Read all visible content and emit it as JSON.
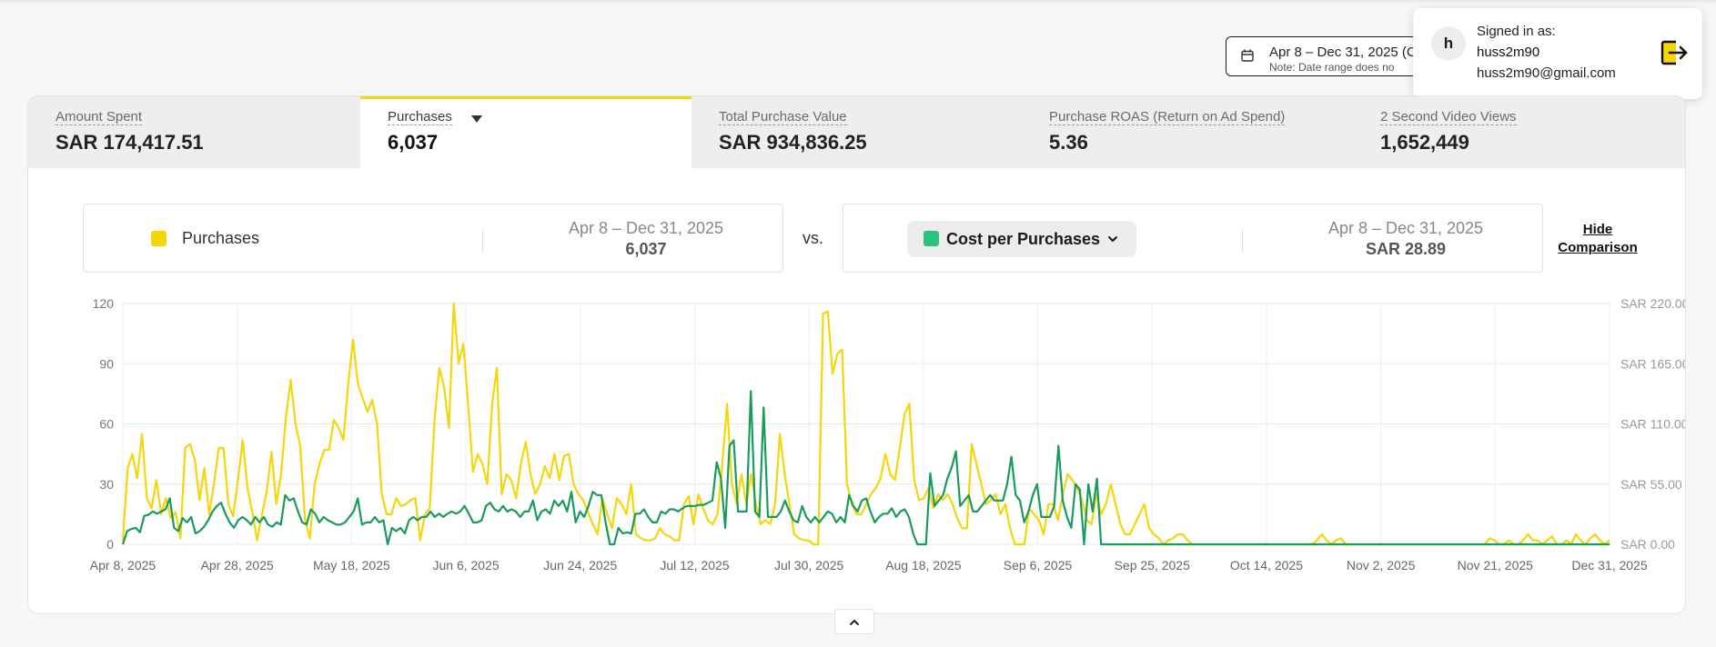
{
  "header": {
    "date_range": "Apr 8 – Dec 31, 2025 (C",
    "date_note": "Note: Date range does no"
  },
  "user": {
    "signed_in_label": "Signed in as:",
    "avatar_initial": "h",
    "username": "huss2m90",
    "email": "huss2m90@gmail.com"
  },
  "metrics": [
    {
      "label": "Amount Spent",
      "value": "SAR 174,417.51"
    },
    {
      "label": "Purchases",
      "value": "6,037",
      "active": true
    },
    {
      "label": "Total Purchase Value",
      "value": "SAR 934,836.25"
    },
    {
      "label": "Purchase ROAS (Return on Ad Spend)",
      "value": "5.36"
    },
    {
      "label": "2 Second Video Views",
      "value": "1,652,449"
    }
  ],
  "comparison": {
    "left_metric": "Purchases",
    "left_range": "Apr 8 – Dec 31, 2025",
    "left_value": "6,037",
    "vs": "vs.",
    "right_metric": "Cost per Purchases",
    "right_range": "Apr 8 – Dec 31, 2025",
    "right_value": "SAR 28.89",
    "hide_line1": "Hide",
    "hide_line2": "Comparison"
  },
  "colors": {
    "accent": "#f5d60a",
    "purchases": "#f5d60a",
    "cost": "#1a9b5c",
    "cost_swatch": "#2ec27e"
  },
  "icons": {
    "date": "calendar-icon",
    "logout": "logout-icon",
    "metric_menu": "chevron-down-icon",
    "collapse": "chevron-up-icon"
  },
  "chart_data": {
    "type": "line",
    "x_ticks": [
      "Apr 8, 2025",
      "Apr 28, 2025",
      "May 18, 2025",
      "Jun 6, 2025",
      "Jun 24, 2025",
      "Jul 12, 2025",
      "Jul 30, 2025",
      "Aug 18, 2025",
      "Sep 6, 2025",
      "Sep 25, 2025",
      "Oct 14, 2025",
      "Nov 2, 2025",
      "Nov 21, 2025",
      "Dec 31, 2025"
    ],
    "y_left_ticks": [
      "0",
      "30",
      "60",
      "90",
      "120"
    ],
    "y_right_ticks": [
      "SAR 0.00",
      "SAR 55.00",
      "SAR 110.00",
      "SAR 165.00",
      "SAR 220.00"
    ],
    "y_left_lim": [
      0,
      120
    ],
    "y_right_lim": [
      0,
      220
    ],
    "grid": true,
    "series": [
      {
        "name": "Purchases",
        "axis": "left",
        "values": [
          2,
          38,
          45,
          33,
          55,
          23,
          18,
          32,
          15,
          23,
          13,
          16,
          3,
          48,
          50,
          42,
          22,
          38,
          15,
          30,
          48,
          48,
          20,
          14,
          32,
          52,
          28,
          16,
          2,
          15,
          26,
          46,
          20,
          35,
          63,
          82,
          60,
          49,
          12,
          3,
          30,
          40,
          47,
          47,
          62,
          58,
          52,
          80,
          102,
          80,
          73,
          66,
          72,
          60,
          25,
          15,
          15,
          23,
          19,
          20,
          22,
          23,
          2,
          15,
          18,
          62,
          88,
          78,
          58,
          120,
          90,
          100,
          70,
          36,
          45,
          40,
          30,
          70,
          88,
          25,
          35,
          32,
          23,
          40,
          51,
          35,
          25,
          30,
          39,
          33,
          45,
          32,
          44,
          45,
          30,
          25,
          22,
          16,
          10,
          5,
          23,
          15,
          8,
          23,
          20,
          15,
          30,
          5,
          3,
          2,
          2,
          3,
          8,
          5,
          4,
          2,
          2,
          20,
          24,
          10,
          25,
          18,
          12,
          10,
          15,
          40,
          70,
          30,
          20,
          35,
          20,
          35,
          20,
          10,
          12,
          10,
          20,
          55,
          35,
          20,
          5,
          3,
          2,
          2,
          0,
          0,
          115,
          116,
          85,
          95,
          97,
          30,
          20,
          15,
          15,
          20,
          25,
          28,
          33,
          45,
          35,
          32,
          48,
          65,
          70,
          32,
          22,
          23,
          28,
          18,
          25,
          22,
          25,
          20,
          13,
          8,
          8,
          50,
          40,
          30,
          20,
          22,
          25,
          15,
          20,
          8,
          0,
          0,
          0,
          18,
          15,
          12,
          5,
          20,
          20,
          12,
          25,
          35,
          32,
          28,
          22,
          12,
          10,
          25,
          15,
          20,
          30,
          20,
          10,
          5,
          5,
          10,
          15,
          20,
          8,
          5,
          3,
          0,
          2,
          3,
          5,
          5,
          2,
          0,
          0,
          0,
          0,
          0,
          0,
          0,
          0,
          0,
          0,
          0,
          0,
          0,
          0,
          0,
          0,
          0,
          0,
          0,
          0,
          0,
          0,
          0,
          0,
          0,
          0,
          2,
          5,
          2,
          0,
          2,
          3,
          0,
          0,
          0,
          0,
          0,
          0,
          0,
          0,
          0,
          0,
          0,
          0,
          0,
          0,
          0,
          0,
          0,
          0,
          0,
          0,
          0,
          0,
          0,
          0,
          0,
          0,
          0,
          0,
          0,
          0,
          3,
          2,
          0,
          0,
          2,
          0,
          0,
          2,
          5,
          2,
          2,
          0,
          2,
          4,
          0,
          0,
          2,
          0,
          5,
          2,
          0,
          3,
          5,
          2,
          0,
          2
        ]
      },
      {
        "name": "Cost per Purchases",
        "axis": "right",
        "values": [
          0,
          12,
          14,
          15,
          11,
          26,
          27,
          30,
          28,
          30,
          32,
          42,
          15,
          12,
          24,
          20,
          25,
          10,
          12,
          16,
          22,
          30,
          35,
          38,
          28,
          20,
          15,
          22,
          25,
          22,
          18,
          25,
          20,
          25,
          18,
          16,
          20,
          18,
          45,
          40,
          42,
          30,
          20,
          18,
          32,
          28,
          20,
          25,
          22,
          20,
          18,
          18,
          20,
          25,
          30,
          42,
          18,
          20,
          20,
          25,
          20,
          22,
          0,
          15,
          12,
          15,
          10,
          22,
          25,
          22,
          25,
          25,
          30,
          25,
          28,
          25,
          28,
          30,
          28,
          30,
          35,
          28,
          20,
          20,
          22,
          35,
          38,
          32,
          30,
          35,
          30,
          32,
          30,
          25,
          30,
          30,
          40,
          22,
          30,
          32,
          28,
          40,
          35,
          40,
          30,
          48,
          20,
          30,
          25,
          35,
          48,
          45,
          45,
          20,
          0,
          0,
          15,
          10,
          11,
          10,
          28,
          28,
          32,
          25,
          20,
          20,
          30,
          28,
          32,
          32,
          30,
          33,
          35,
          35,
          35,
          36,
          36,
          38,
          40,
          75,
          60,
          15,
          90,
          95,
          30,
          30,
          30,
          140,
          30,
          25,
          125,
          25,
          25,
          25,
          30,
          40,
          30,
          22,
          20,
          35,
          25,
          20,
          25,
          20,
          25,
          30,
          28,
          20,
          25,
          20,
          45,
          35,
          30,
          40,
          42,
          30,
          20,
          25,
          28,
          28,
          33,
          25,
          30,
          32,
          25,
          10,
          0,
          0,
          0,
          65,
          35,
          40,
          45,
          60,
          70,
          85,
          35,
          40,
          45,
          30,
          30,
          35,
          40,
          45,
          40,
          40,
          40,
          55,
          80,
          45,
          40,
          20,
          30,
          45,
          55,
          25,
          25,
          25,
          35,
          90,
          40,
          25,
          15,
          55,
          50,
          0,
          55,
          30,
          60,
          0,
          0,
          0,
          0,
          0,
          0,
          0,
          0,
          0,
          0,
          0,
          0,
          0,
          0,
          0,
          0,
          0,
          0,
          0,
          0,
          0,
          0,
          0,
          0,
          0,
          0,
          0,
          0,
          0,
          0,
          0,
          0,
          0,
          0,
          0,
          0,
          0,
          0,
          0,
          0,
          0,
          0,
          0,
          0,
          0,
          0,
          0,
          0,
          0,
          0,
          0,
          0,
          0,
          0,
          0,
          0,
          0,
          0,
          0,
          0,
          0,
          0,
          0,
          0,
          0,
          0,
          0,
          0,
          0,
          0,
          0,
          0,
          0,
          0,
          0,
          0,
          0,
          0,
          0,
          0,
          0,
          0,
          0,
          0,
          0,
          0,
          0,
          0,
          0,
          0,
          0,
          0,
          0,
          0,
          0,
          0,
          0,
          0,
          0,
          0,
          0,
          0,
          0,
          0,
          0,
          0,
          0,
          0,
          0,
          0,
          0,
          0,
          0,
          0,
          0,
          0,
          0,
          0,
          0,
          0
        ]
      }
    ]
  }
}
